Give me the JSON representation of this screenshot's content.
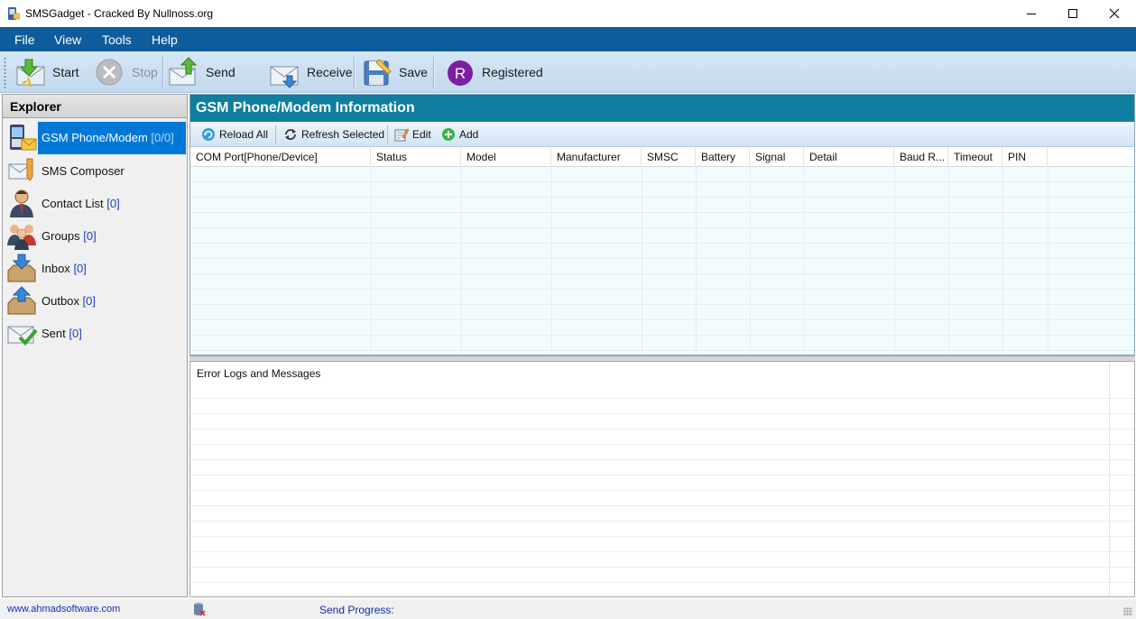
{
  "window": {
    "title": "SMSGadget - Cracked By Nullnoss.org",
    "controls": {
      "minimize": "minimize-icon",
      "maximize": "maximize-icon",
      "close": "close-icon"
    }
  },
  "menu": [
    "File",
    "View",
    "Tools",
    "Help"
  ],
  "toolbar": {
    "start": "Start",
    "stop": "Stop",
    "send": "Send",
    "receive": "Receive",
    "save": "Save",
    "registered": "Registered",
    "registered_badge": "R",
    "registered_color": "#7b1fa2"
  },
  "explorer": {
    "title": "Explorer",
    "items": [
      {
        "label": "GSM Phone/Modem",
        "count": "[0/0]",
        "icon": "phone-modem-icon",
        "selected": true
      },
      {
        "label": "SMS Composer",
        "count": "",
        "icon": "sms-composer-icon"
      },
      {
        "label": "Contact List",
        "count": "[0]",
        "icon": "contact-icon"
      },
      {
        "label": "Groups",
        "count": "[0]",
        "icon": "groups-icon"
      },
      {
        "label": "Inbox",
        "count": "[0]",
        "icon": "inbox-icon"
      },
      {
        "label": "Outbox",
        "count": "[0]",
        "icon": "outbox-icon"
      },
      {
        "label": "Sent",
        "count": "[0]",
        "icon": "sent-icon"
      }
    ]
  },
  "main": {
    "title": "GSM Phone/Modem Information",
    "tools": {
      "reload_all": "Reload All",
      "refresh_selected": "Refresh Selected",
      "edit": "Edit",
      "add": "Add"
    },
    "columns": [
      "COM Port[Phone/Device]",
      "Status",
      "Model",
      "Manufacturer",
      "SMSC",
      "Battery",
      "Signal",
      "Detail",
      "Baud R...",
      "Timeout",
      "PIN"
    ]
  },
  "logs": {
    "header": "Error Logs and Messages"
  },
  "status": {
    "link": "www.ahmadsoftware.com",
    "send_progress": "Send Progress:"
  },
  "colors": {
    "menubar": "#0e5c9b",
    "panel_header": "#107e9e",
    "selection": "#0078d7"
  }
}
